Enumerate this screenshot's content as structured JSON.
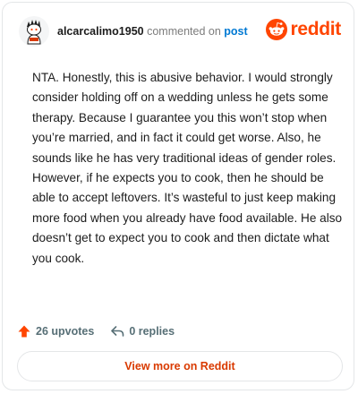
{
  "header": {
    "username": "alcarcalimo1950",
    "commented_text": "commented on",
    "post_link": "post",
    "brand": "reddit"
  },
  "comment": {
    "text": "NTA. Honestly, this is abusive behavior. I would strongly consider holding off on a wedding unless he gets some therapy. Because I guarantee you this won’t stop when you’re married, and in fact it could get worse. Also, he sounds like he has very traditional ideas of gender roles. However, if he expects you to cook, then he should be able to accept leftovers. It’s wasteful to just keep making more food when you already have food available. He also doesn’t get to expect you to cook and then dictate what you cook."
  },
  "footer": {
    "upvotes": "26 upvotes",
    "replies": "0 replies"
  },
  "cta": {
    "label": "View more on Reddit"
  },
  "colors": {
    "brand": "#ff4500",
    "link": "#0079d3",
    "cta": "#d93a00"
  },
  "icons": [
    "avatar-icon",
    "reddit-logo-icon",
    "upvote-arrow-icon",
    "reply-arrow-icon"
  ]
}
